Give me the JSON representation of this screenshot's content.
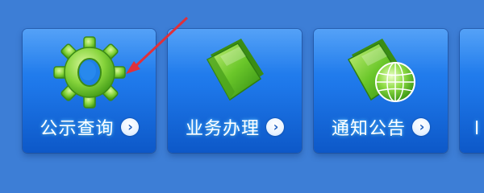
{
  "tiles": [
    {
      "label": "公示查询",
      "icon": "gear-icon",
      "chevron": "›"
    },
    {
      "label": "业务办理",
      "icon": "folder-icon",
      "chevron": "›"
    },
    {
      "label": "通知公告",
      "icon": "globe-folder-icon",
      "chevron": "›"
    },
    {
      "label": "",
      "icon": "",
      "chevron": ""
    }
  ],
  "colors": {
    "background": "#3d7ed6",
    "tile_top": "#2f8df5",
    "tile_bottom": "#0d58c8",
    "icon_green": "#7fd23c",
    "annotation_arrow": "#e0303a"
  }
}
